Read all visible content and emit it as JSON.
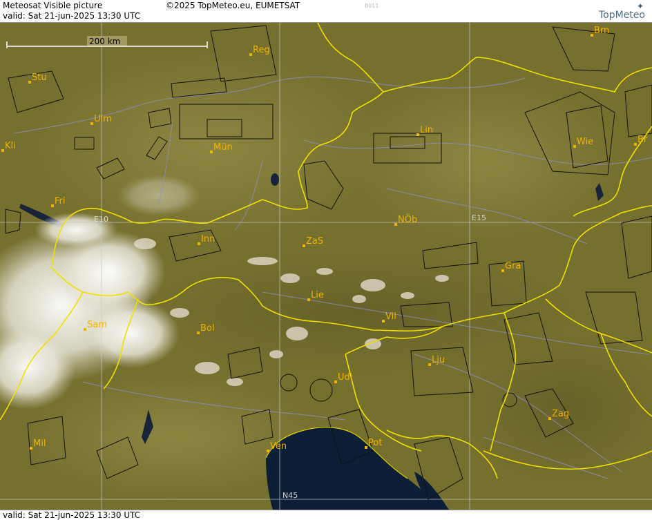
{
  "header": {
    "title": "Meteosat Visible picture",
    "valid": "valid:  Sat  21-jun-2025  13:30 UTC",
    "copyright": "©2025 TopMeteo.eu, EUMETSAT",
    "code": "8011"
  },
  "logo": {
    "text": "TopMeteo",
    "icon": "star-icon"
  },
  "footer": {
    "valid": "valid:  Sat  21-jun-2025  13:30 UTC"
  },
  "scale": {
    "label": "200 km"
  },
  "grid_labels": {
    "e10": "E10",
    "e15": "E15",
    "n45": "N45"
  },
  "cities": [
    {
      "id": "reg",
      "label": "Reg"
    },
    {
      "id": "brn",
      "label": "Brn"
    },
    {
      "id": "stu",
      "label": "Stu"
    },
    {
      "id": "ulm",
      "label": "Ulm"
    },
    {
      "id": "mun",
      "label": "Mün"
    },
    {
      "id": "lin",
      "label": "Lin"
    },
    {
      "id": "wie",
      "label": "Wie"
    },
    {
      "id": "bra",
      "label": "Br"
    },
    {
      "id": "kli",
      "label": "Kli"
    },
    {
      "id": "fri",
      "label": "Fri"
    },
    {
      "id": "nob",
      "label": "NÖb"
    },
    {
      "id": "inn",
      "label": "Inn"
    },
    {
      "id": "zas",
      "label": "ZaS"
    },
    {
      "id": "gra",
      "label": "Gra"
    },
    {
      "id": "lie",
      "label": "Lie"
    },
    {
      "id": "vil",
      "label": "Vil"
    },
    {
      "id": "sam",
      "label": "Sam"
    },
    {
      "id": "bol",
      "label": "Bol"
    },
    {
      "id": "lju",
      "label": "Lju"
    },
    {
      "id": "udi",
      "label": "Udi"
    },
    {
      "id": "zag",
      "label": "Zag"
    },
    {
      "id": "mil",
      "label": "Mil"
    },
    {
      "id": "pot",
      "label": "Pot"
    },
    {
      "id": "ven",
      "label": "Ven"
    }
  ]
}
